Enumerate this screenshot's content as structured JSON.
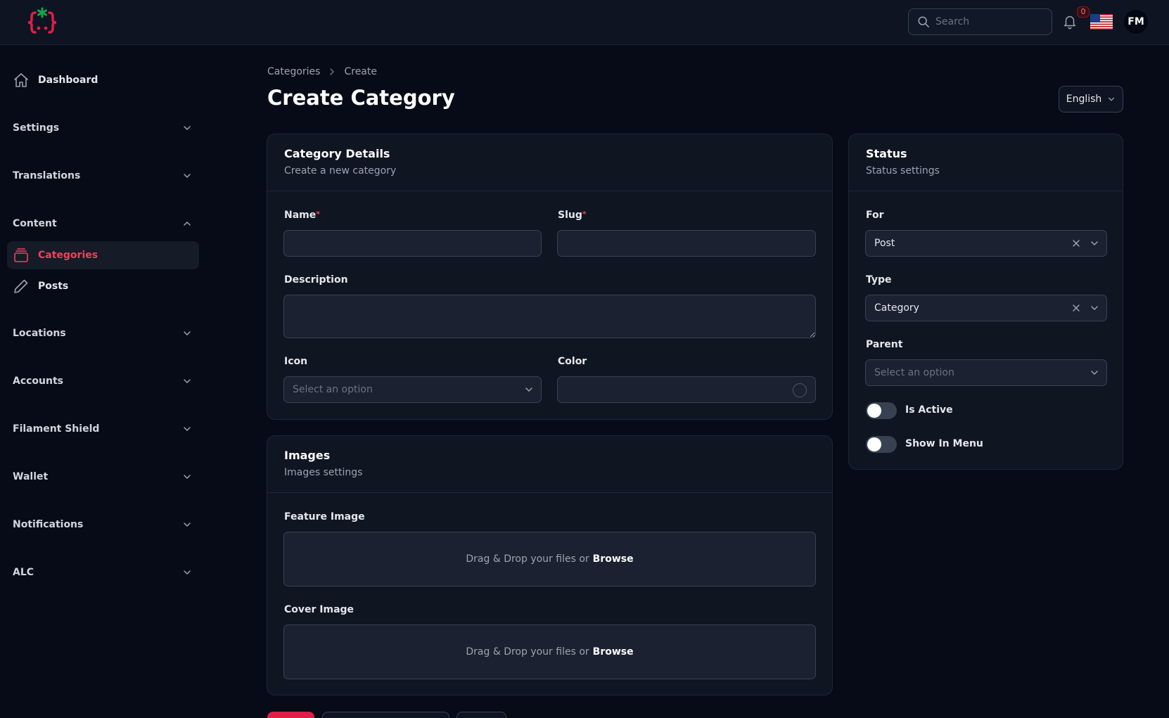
{
  "topbar": {
    "search_placeholder": "Search",
    "notifications_count": "0",
    "avatar_initials": "FM"
  },
  "sidebar": {
    "dashboard": "Dashboard",
    "groups": {
      "settings": "Settings",
      "translations": "Translations",
      "content": "Content",
      "locations": "Locations",
      "accounts": "Accounts",
      "filament_shield": "Filament Shield",
      "wallet": "Wallet",
      "notifications": "Notifications",
      "alc": "ALC"
    },
    "content_items": {
      "categories": "Categories",
      "posts": "Posts"
    }
  },
  "breadcrumb": {
    "parent": "Categories",
    "current": "Create"
  },
  "page": {
    "title": "Create Category",
    "language": "English"
  },
  "details_card": {
    "title": "Category Details",
    "subtitle": "Create a new category",
    "name_label": "Name",
    "name_value": "",
    "slug_label": "Slug",
    "slug_value": "",
    "required_mark": "*",
    "description_label": "Description",
    "description_value": "",
    "icon_label": "Icon",
    "icon_placeholder": "Select an option",
    "color_label": "Color",
    "color_value": ""
  },
  "images_card": {
    "title": "Images",
    "subtitle": "Images settings",
    "feature_label": "Feature Image",
    "cover_label": "Cover Image",
    "drop_text": "Drag & Drop your files or",
    "browse_text": "Browse"
  },
  "status_card": {
    "title": "Status",
    "subtitle": "Status settings",
    "for_label": "For",
    "for_value": "Post",
    "type_label": "Type",
    "type_value": "Category",
    "parent_label": "Parent",
    "parent_placeholder": "Select an option",
    "is_active_label": "Is Active",
    "is_active_on": false,
    "show_in_menu_label": "Show In Menu",
    "show_in_menu_on": false
  },
  "colors": {
    "accent": "#f43f5e",
    "primary_button": "#e11d48",
    "background": "#070b17",
    "card": "#101522"
  }
}
